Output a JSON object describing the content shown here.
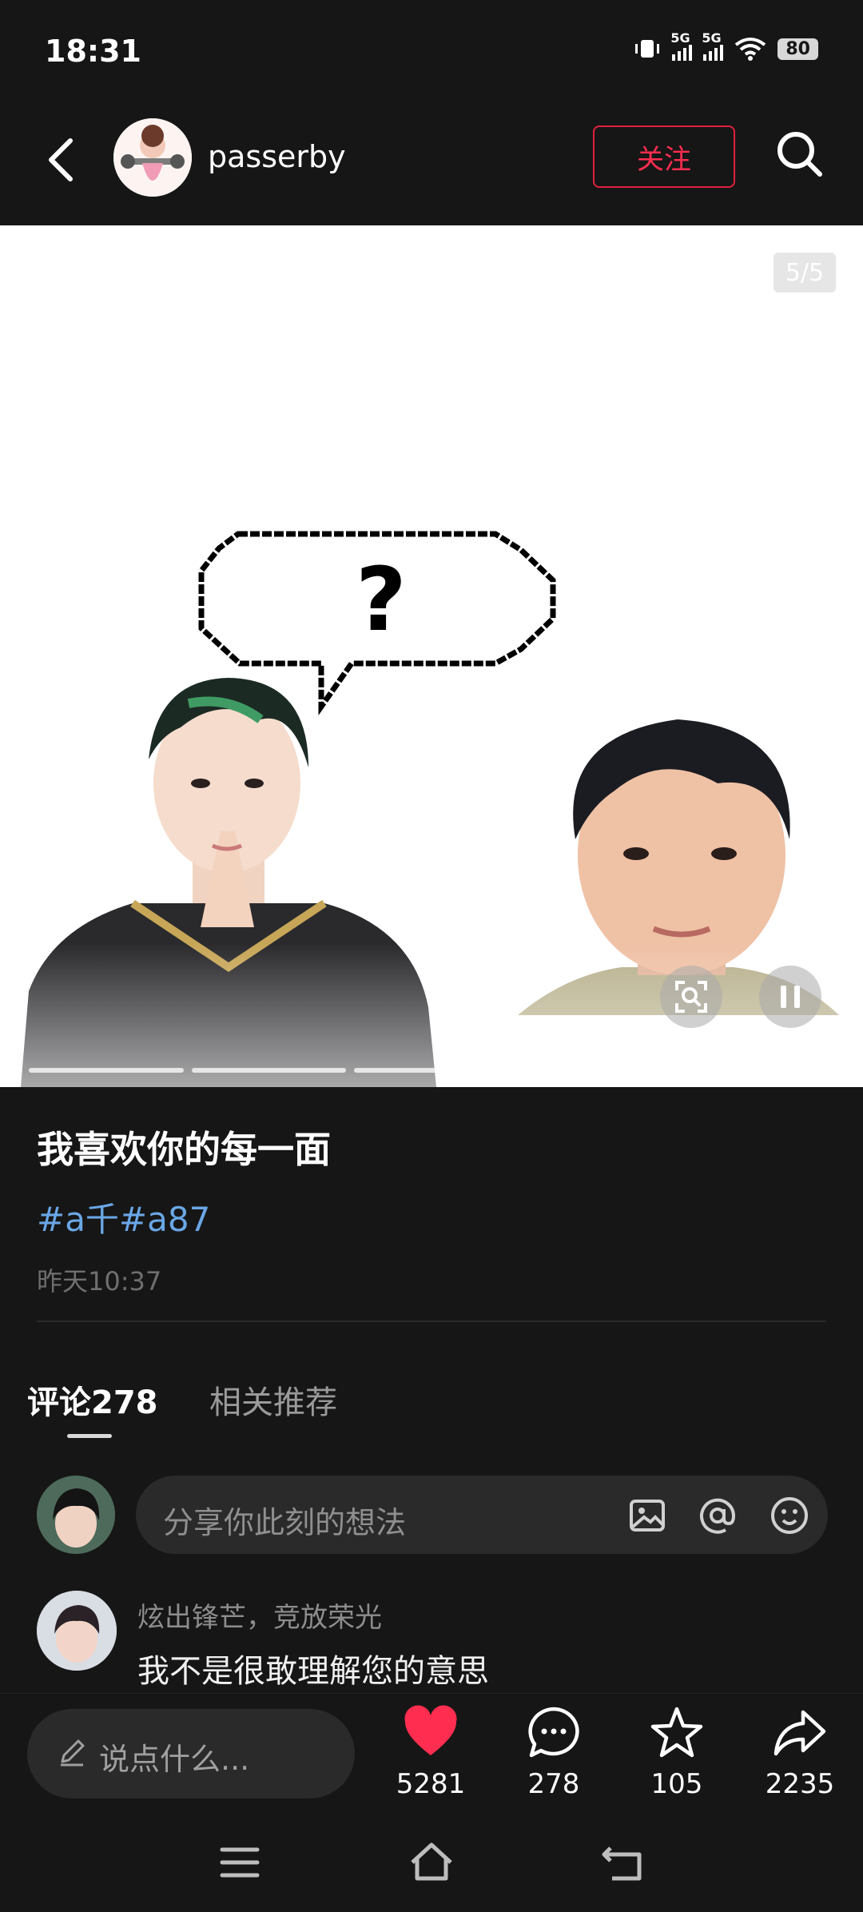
{
  "status_bar": {
    "time": "18:31",
    "network_1": "5G",
    "network_2": "5G",
    "battery": "80"
  },
  "header": {
    "username": "passerby",
    "follow_label": "关注"
  },
  "media": {
    "page_counter": "5/5",
    "progress_total": 5,
    "progress_current": 5
  },
  "post": {
    "title": "我喜欢你的每一面",
    "tags": "#a千#a87",
    "date": "昨天10:37"
  },
  "tabs": {
    "comments": "评论278",
    "related": "相关推荐"
  },
  "comment_input": {
    "placeholder": "分享你此刻的想法"
  },
  "comments": [
    {
      "author": "炫出锋芒，竞放荣光",
      "text": "我不是很敢理解您的意思"
    }
  ],
  "action_bar": {
    "say_placeholder": "说点什么...",
    "likes": "5281",
    "comments": "278",
    "favorites": "105",
    "shares": "2235"
  },
  "colors": {
    "background": "#161616",
    "accent_red": "#ff2d4f",
    "tag_blue": "#6aa7e6",
    "like_red": "#ff2d4f"
  },
  "icons": {
    "back": "chevron-left-icon",
    "search": "search-icon",
    "image": "image-icon",
    "mention": "at-icon",
    "emoji": "emoji-icon",
    "like": "heart-icon",
    "comment": "comment-bubble-icon",
    "favorite": "star-icon",
    "share": "share-arrow-icon"
  }
}
